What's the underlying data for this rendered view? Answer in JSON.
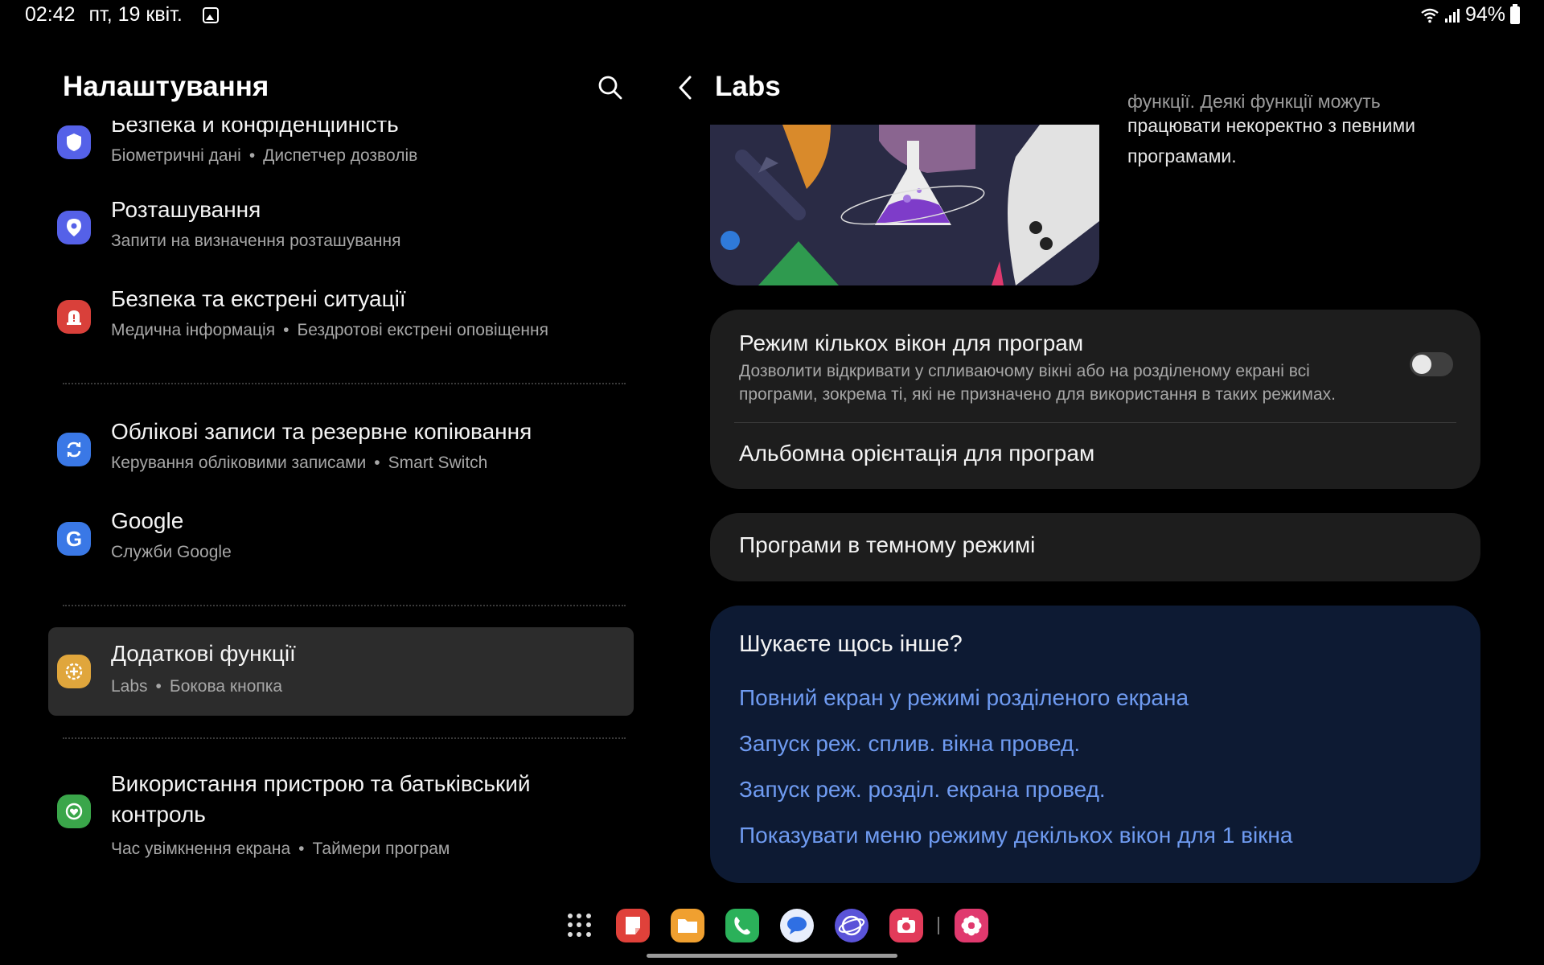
{
  "status_bar": {
    "time": "02:42",
    "date": "пт, 19 квіт.",
    "notification_icon": "gallery-icon",
    "battery": "94%"
  },
  "left_panel": {
    "title": "Налаштування",
    "search_icon": "search-icon",
    "items": [
      {
        "title": "Безпека и конфіденційність",
        "subtitle_parts": [
          "Біометричні дані",
          "Диспетчер дозволів"
        ],
        "icon": "shield-icon",
        "color": "#5561e8"
      },
      {
        "title": "Розташування",
        "subtitle_parts": [
          "Запити на визначення розташування"
        ],
        "icon": "location-pin-icon",
        "color": "#5561e8"
      },
      {
        "title": "Безпека та екстрені ситуації",
        "subtitle_parts": [
          "Медична інформація",
          "Бездротові екстрені оповіщення"
        ],
        "icon": "emergency-siren-icon",
        "color": "#d9403a"
      },
      {
        "title": "Облікові записи та резервне копіювання",
        "subtitle_parts": [
          "Керування обліковими записами",
          "Smart Switch"
        ],
        "icon": "sync-icon",
        "color": "#3a78e6"
      },
      {
        "title": "Google",
        "subtitle_parts": [
          "Служби Google"
        ],
        "icon": "google-icon",
        "color": "#3a78e6"
      },
      {
        "title": "Додаткові функції",
        "subtitle_parts": [
          "Labs",
          "Бокова кнопка"
        ],
        "icon": "plus-gear-icon",
        "color": "#e0a63c",
        "selected": true
      },
      {
        "title_line1": "Використання пристрою та батьківський",
        "title_line2": "контроль",
        "subtitle_parts": [
          "Час увімкнення екрана",
          "Таймери програм"
        ],
        "icon": "wellbeing-icon",
        "color": "#3aa64a"
      }
    ]
  },
  "right_panel": {
    "title": "Labs",
    "back_icon": "back-chevron-icon",
    "illustration_desc_line0": "функції. Деякі функції можуть",
    "illustration_desc_line1": "працювати некоректно з певними",
    "illustration_desc_line2": "програмами.",
    "multi_window": {
      "title": "Режим кількох вікон для програм",
      "subtitle": "Дозволити відкривати у спливаючому вікні або на розділеному екрані всі програми, зокрема ті, які не призначено для використання в таких режимах.",
      "toggle_on": false
    },
    "landscape": {
      "title": "Альбомна орієнтація для програм"
    },
    "dark_mode": {
      "title": "Програми в темному режимі"
    },
    "suggestions": {
      "heading": "Шукаєте щось інше?",
      "links": [
        "Повний екран у режимі розділеного екрана",
        "Запуск реж. сплив. вікна провед.",
        "Запуск реж. розділ. екрана провед.",
        "Показувати меню режиму декількох вікон для 1 вікна"
      ]
    }
  },
  "dock": {
    "apps": [
      {
        "name": "apps-grid-icon"
      },
      {
        "name": "samsung-notes-icon",
        "color": "#e0413a"
      },
      {
        "name": "my-files-icon",
        "color": "#f0a030"
      },
      {
        "name": "phone-icon",
        "color": "#2bb15a"
      },
      {
        "name": "messages-icon",
        "color": "#e8eefc"
      },
      {
        "name": "internet-browser-icon",
        "color": "#5a53d8"
      },
      {
        "name": "camera-icon",
        "color": "#e23b5a"
      },
      {
        "name": "bixby-flower-icon",
        "color": "#e0396e"
      }
    ]
  }
}
